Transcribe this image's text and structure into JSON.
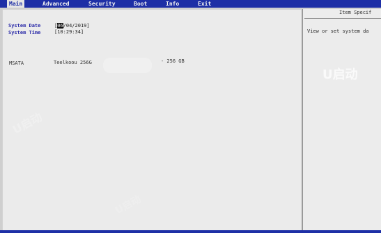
{
  "menu": {
    "tabs": [
      {
        "label": "Main",
        "active": true
      },
      {
        "label": "Advanced"
      },
      {
        "label": "Security"
      },
      {
        "label": "Boot"
      },
      {
        "label": "Info"
      },
      {
        "label": "Exit"
      }
    ]
  },
  "main": {
    "system_date": {
      "label": "System Date",
      "bracket_open": "[",
      "month": "06",
      "rest": "/04/2019]"
    },
    "system_time": {
      "label": "System Time",
      "value": "[10:29:34]"
    },
    "device": {
      "type": "MSATA",
      "name": "Teelkoou 256G",
      "size": "- 256 GB"
    }
  },
  "help": {
    "title": "Item Specif",
    "text": "View or set system da"
  },
  "watermarks": [
    "U启动",
    "U启动",
    "U启动"
  ],
  "colors": {
    "menubar": "#1e2fa6",
    "content_bg": "#ebebeb",
    "label_blue": "#2a2aa8"
  }
}
